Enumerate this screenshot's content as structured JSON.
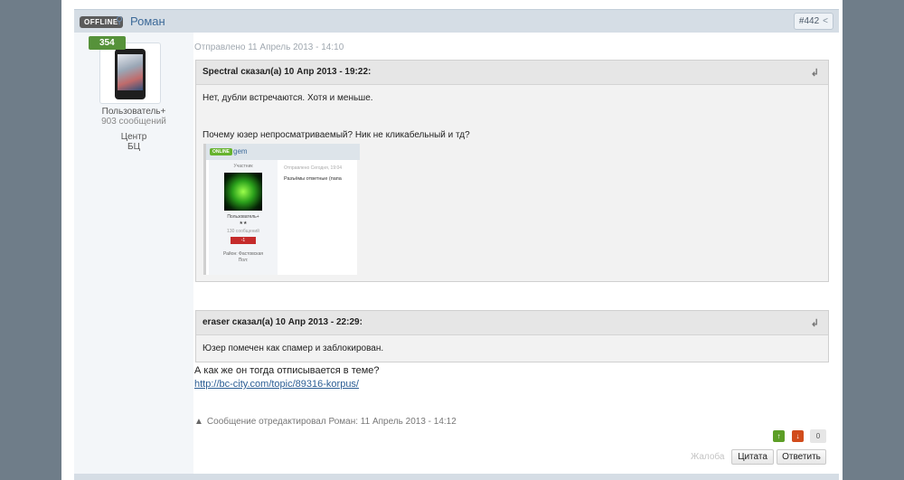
{
  "header": {
    "status": "OFFLINE",
    "author": "Роман",
    "post_number": "#442"
  },
  "author": {
    "reputation": "354",
    "rank": "Пользователь+",
    "posts": "903 сообщений",
    "location_line1": "Центр",
    "location_line2": "БЦ"
  },
  "post": {
    "date": "Отправлено 11 Апрель 2013 - 14:10",
    "quote1": {
      "header": "Spectral сказал(а) 10 Апр 2013 - 19:22:",
      "line1": "Нет, дубли встречаются. Хотя и меньше.",
      "line2": "Почему юзер непросматриваемый? Ник не кликабельный и тд?"
    },
    "embedded": {
      "status": "ONLINE",
      "name": "gem",
      "role": "Участник",
      "date": "Отправлено Сегодня, 19:04",
      "text": "Разъёмы ответные (папа",
      "rank": "Пользователь+",
      "stars": "★★",
      "posts": "130 сообщений",
      "rep": "-1",
      "region": "Район: Фастовская",
      "gender": "Пол:"
    },
    "quote2": {
      "header": "eraser сказал(а) 10 Апр 2013 - 22:29:",
      "line1": "Юзер помечен как спамер и заблокирован."
    },
    "reply_text": "А как же он тогда отписывается в теме?",
    "reply_link": "http://bc-city.com/topic/89316-korpus/",
    "edit_note": "Сообщение отредактировал Роман: 11 Апрель 2013 - 14:12"
  },
  "actions": {
    "vote_count": "0",
    "report": "Жалоба",
    "quote": "Цитата",
    "reply": "Ответить"
  },
  "colors": {
    "background": "#6f7d89",
    "header_bar": "#d5dde5",
    "link": "#2b5d94",
    "rep_positive": "#56923a"
  }
}
